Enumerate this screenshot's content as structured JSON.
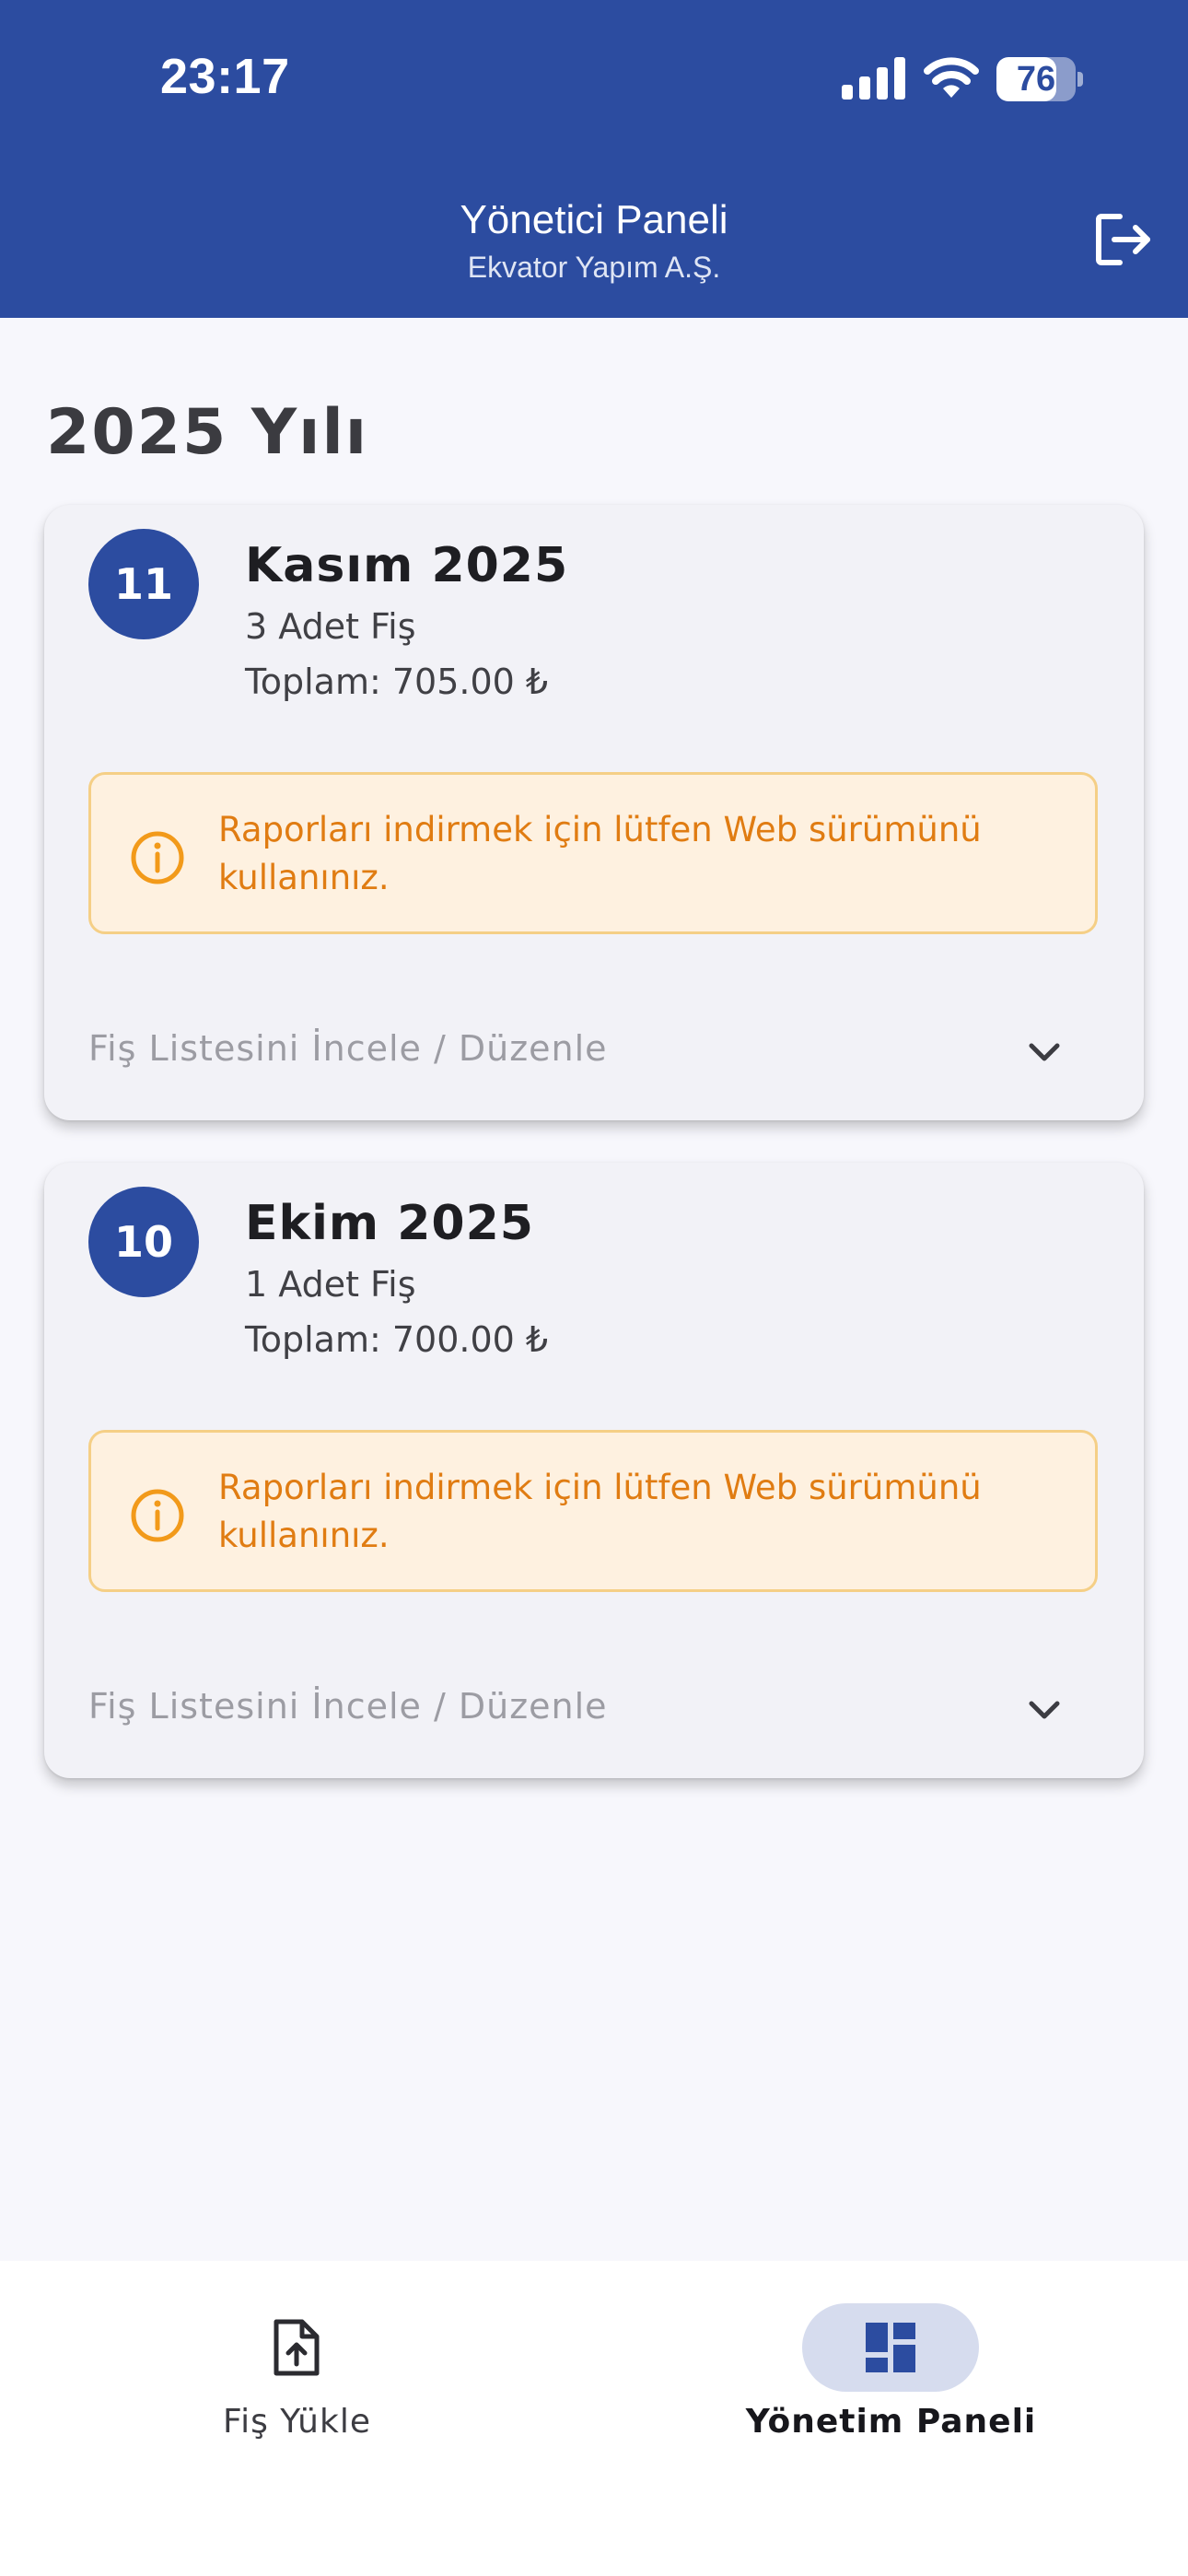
{
  "status_bar": {
    "time": "23:17",
    "battery_level": "76",
    "battery_fraction": 0.76
  },
  "header": {
    "title": "Yönetici Paneli",
    "subtitle": "Ekvator Yapım A.Ş.",
    "logout_icon": "logout-icon"
  },
  "main": {
    "year_title": "2025 Yılı",
    "months": [
      {
        "number": "11",
        "name": "Kasım 2025",
        "receipt_count": "3 Adet Fiş",
        "total": "Toplam: 705.00 ₺",
        "warning": "Raporları indirmek için lütfen Web sürümünü kullanınız.",
        "expand_label": "Fiş Listesini İncele / Düzenle"
      },
      {
        "number": "10",
        "name": "Ekim 2025",
        "receipt_count": "1 Adet Fiş",
        "total": "Toplam: 700.00 ₺",
        "warning": "Raporları indirmek için lütfen Web sürümünü kullanınız.",
        "expand_label": "Fiş Listesini İncele / Düzenle"
      }
    ]
  },
  "bottom_nav": {
    "items": [
      {
        "label": "Fiş Yükle",
        "icon": "file-upload-icon",
        "active": false
      },
      {
        "label": "Yönetim Paneli",
        "icon": "dashboard-icon",
        "active": true
      }
    ]
  },
  "colors": {
    "primary": "#2c4ca0",
    "warning_text": "#e07c12",
    "warning_bg": "#fef1e0",
    "warning_border": "#f5cf86",
    "active_nav_pill": "#d6dcee"
  }
}
